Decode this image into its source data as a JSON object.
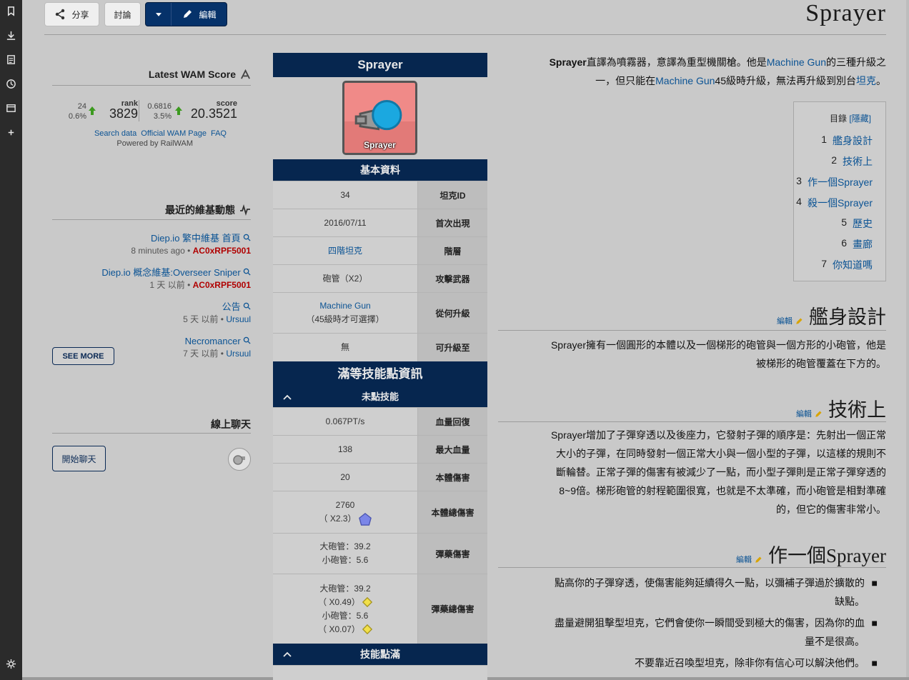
{
  "toolbar": {
    "share_label": "分享",
    "talk_label": "討論",
    "edit_label": "編輯"
  },
  "page": {
    "title": "Sprayer"
  },
  "article": {
    "intro_line1_prefix": "Sprayer",
    "intro_line1_rest": "直譯為噴霧器，意譯為重型機關槍。他是",
    "intro_link_mg": "Machine Gun",
    "intro_line1_tail": "的三種升級之",
    "intro_line2_a": "一，但只能在",
    "intro_line2_link": "Machine Gun",
    "intro_line2_b": "45級時升級，無法再升級到別台",
    "intro_line2_link2": "坦克",
    "intro_line2_c": "。",
    "toc": {
      "title": "目錄",
      "hide": "[隱藏]",
      "items": [
        {
          "n": "1",
          "label": "艦身設計"
        },
        {
          "n": "2",
          "label": "技術上"
        },
        {
          "n": "3",
          "label": "作一個Sprayer"
        },
        {
          "n": "4",
          "label": "殺一個Sprayer"
        },
        {
          "n": "5",
          "label": "歷史"
        },
        {
          "n": "6",
          "label": "畫廊"
        },
        {
          "n": "7",
          "label": "你知道嗎"
        }
      ]
    },
    "edit_link": "編輯",
    "sec1": {
      "title": "艦身設計",
      "p_line1": "Sprayer擁有一個圓形的本體以及一個梯形的砲管與一個方形的小砲管，他是",
      "p_line2": "被梯形的砲管覆蓋在下方的。"
    },
    "sec2": {
      "title": "技術上",
      "lines": [
        "Sprayer增加了子彈穿透以及後座力，它發射子彈的順序是：先射出一個正常",
        "大小的子彈，在同時發射一個正常大小與一個小型的子彈，以這樣的規則不",
        "斷輪替。正常子彈的傷害有被減少了一點，而小型子彈則是正常子彈穿透的",
        "8~9倍。梯形砲管的射程範圍很寬，也就是不太準確，而小砲管是相對準確",
        "的，但它的傷害非常小。"
      ]
    },
    "sec3": {
      "title": "作一個Sprayer",
      "bullets": [
        [
          "點高你的子彈穿透，使傷害能夠延續得久一點，以彌補子彈過於擴散的",
          "缺點。"
        ],
        [
          "盡量避開狙擊型坦克，它們會使你一瞬間受到極大的傷害，因為你的血",
          "量不是很高。"
        ],
        [
          "不要靠近召喚型坦克，除非你有信心可以解決他們。"
        ]
      ]
    }
  },
  "infobox": {
    "title": "Sprayer",
    "image_caption": "Sprayer",
    "basic_header": "基本資料",
    "rows": [
      {
        "label": "坦克ID",
        "value": "34"
      },
      {
        "label": "首次出現",
        "value": "2016/07/11"
      },
      {
        "label": "階層",
        "value": "四階坦克"
      },
      {
        "label": "攻擊武器",
        "value": "砲管（X2）"
      },
      {
        "label": "從何升級",
        "value": "Machine Gun",
        "value2": "（45級時才可選擇）"
      },
      {
        "label": "可升級至",
        "value": "無"
      }
    ],
    "maxed_header": "滿等技能點資訊",
    "unspent_header": "未點技能",
    "stats": [
      {
        "label": "血量回復",
        "value": "0.067PT/s"
      },
      {
        "label": "最大血量",
        "value": "138"
      },
      {
        "label": "本體傷害",
        "value": "20"
      },
      {
        "label": "本體總傷害",
        "value": "2760",
        "value2": "（ X2.3）"
      },
      {
        "label": "彈藥傷害",
        "value": "大砲管：39.2",
        "value2": "小砲管：5.6"
      },
      {
        "label": "彈藥總傷害",
        "value": "大砲管：39.2",
        "value2": "（ X0.49）",
        "value3": "小砲管：5.6",
        "value4": "（ X0.07）"
      }
    ],
    "skill_header": "技能點滿"
  },
  "sidebar": {
    "waw": {
      "title": "Latest WAM Score",
      "score_label": "score",
      "score": "20.3521",
      "score_delta": "0.6816",
      "score_pct": "3.5%",
      "rank_label": "rank",
      "rank": "3829",
      "rank_delta": "24",
      "rank_pct": "0.6%",
      "links": [
        "FAQ",
        "Official WAM Page",
        "Search data"
      ],
      "powered": "Powered by RailWAM"
    },
    "activity": {
      "title": "最近的維基動態",
      "items": [
        {
          "title": "Diep.io 繁中維基 首頁",
          "user": "AC0xRPF5001",
          "time": "8 minutes ago"
        },
        {
          "title": "Diep.io 概念維基:Overseer Sniper",
          "user": "AC0xRPF5001",
          "time": "1 天 以前"
        },
        {
          "title": "公告",
          "user": "Ursuul",
          "time": "5 天 以前"
        },
        {
          "title": "Necromancer",
          "user": "Ursuul",
          "time": "7 天 以前"
        }
      ],
      "see_more": "SEE MORE"
    },
    "chat": {
      "title": "線上聊天",
      "button": "開始聊天"
    }
  },
  "colors": {
    "accent": "#06264f",
    "link": "#0b5394",
    "user": "#b00000",
    "up": "#3c9a1f"
  }
}
